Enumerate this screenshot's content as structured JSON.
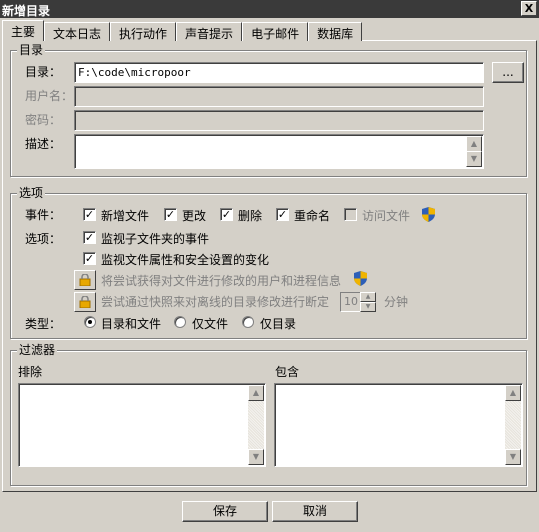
{
  "window": {
    "title": "新增目录",
    "close_label": "X"
  },
  "tabs": [
    {
      "label": "主要"
    },
    {
      "label": "文本日志"
    },
    {
      "label": "执行动作"
    },
    {
      "label": "声音提示"
    },
    {
      "label": "电子邮件"
    },
    {
      "label": "数据库"
    }
  ],
  "directory_group": {
    "title": "目录",
    "dir_label": "目录：",
    "dir_value": "F:\\code\\micropoor",
    "browse_label": "...",
    "username_label": "用户名：",
    "username_value": "",
    "password_label": "密码：",
    "password_value": "",
    "description_label": "描述：",
    "description_value": ""
  },
  "options_group": {
    "title": "选项",
    "events_label": "事件：",
    "events": [
      {
        "label": "新增文件",
        "checked": true
      },
      {
        "label": "更改",
        "checked": true
      },
      {
        "label": "删除",
        "checked": true
      },
      {
        "label": "重命名",
        "checked": true
      },
      {
        "label": "访问文件",
        "checked": false
      }
    ],
    "options_label": "选项：",
    "watch_subfolders": "监视子文件夹的事件",
    "watch_attributes": "监视文件属性和安全设置的变化",
    "try_get_user": "将尝试获得对文件进行修改的用户和进程信息",
    "try_detect_offline": "尝试通过快照来对离线的目录修改进行断定",
    "interval_value": "10",
    "interval_unit": "分钟",
    "type_label": "类型：",
    "types": [
      {
        "label": "目录和文件",
        "selected": true
      },
      {
        "label": "仅文件",
        "selected": false
      },
      {
        "label": "仅目录",
        "selected": false
      }
    ]
  },
  "filter_group": {
    "title": "过滤器",
    "exclude_label": "排除",
    "include_label": "包含"
  },
  "footer": {
    "save_label": "保存",
    "cancel_label": "取消"
  },
  "colors": {
    "titlebar": "#3a3a3a",
    "face": "#d4d0c8",
    "shield_blue": "#2d5fb8",
    "shield_gold": "#f0b400"
  }
}
